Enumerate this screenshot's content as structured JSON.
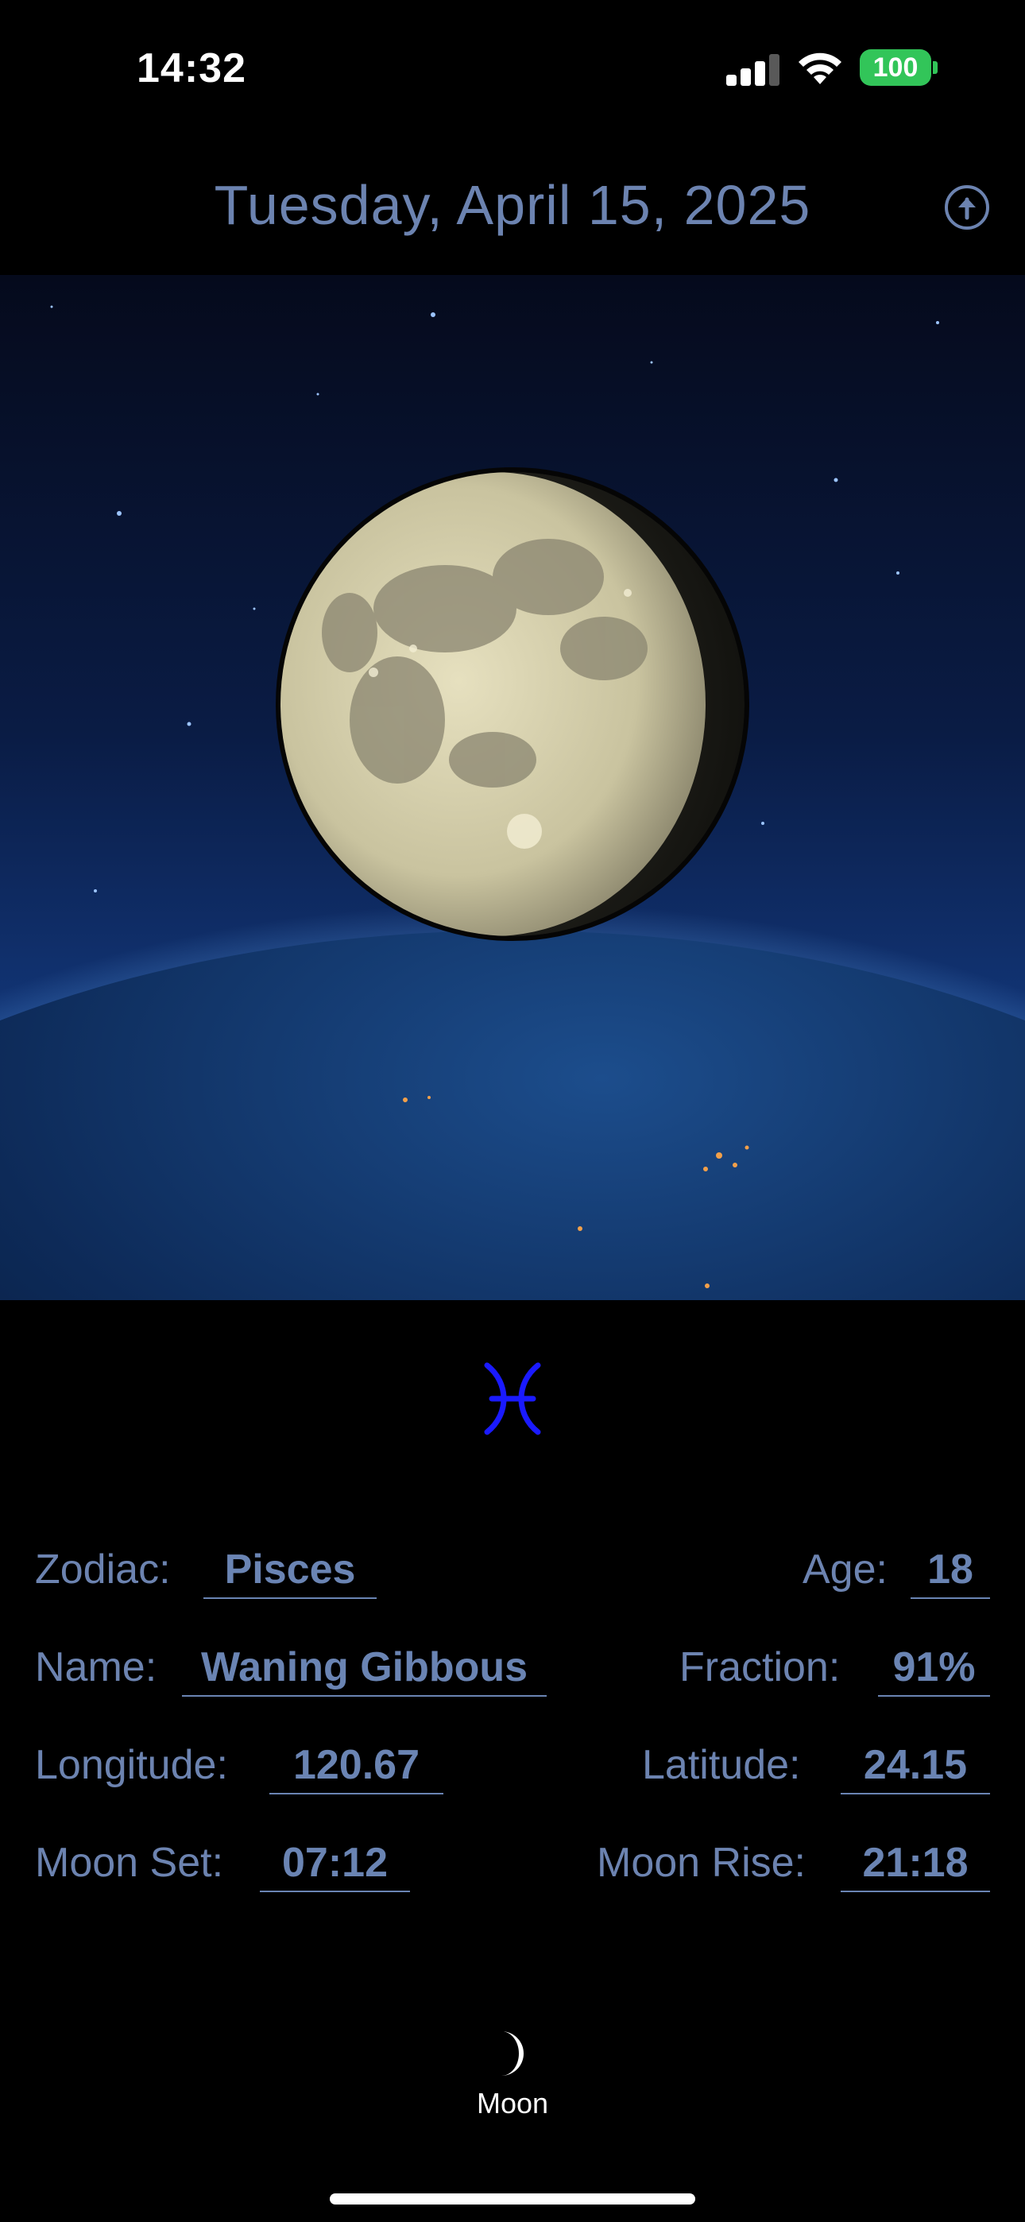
{
  "status_bar": {
    "time": "14:32",
    "battery": "100",
    "icons": [
      "cellular-signal-icon",
      "wifi-icon",
      "battery-icon"
    ]
  },
  "header": {
    "date": "Tuesday, April 15, 2025",
    "action_icon": "upload-arrow-circle-icon"
  },
  "scene": {
    "image": "moon-over-earth-illustration",
    "phase_fraction": 0.91
  },
  "zodiac": {
    "symbol": "♓",
    "icon": "pisces-icon"
  },
  "info": {
    "zodiac_label": "Zodiac:",
    "zodiac_value": "Pisces",
    "age_label": "Age:",
    "age_value": "18",
    "name_label": "Name:",
    "name_value": "Waning Gibbous",
    "fraction_label": "Fraction:",
    "fraction_value": "91%",
    "longitude_label": "Longitude:",
    "longitude_value": "120.67",
    "latitude_label": "Latitude:",
    "latitude_value": "24.15",
    "moonset_label": "Moon Set:",
    "moonset_value": "07:12",
    "moonrise_label": "Moon Rise:",
    "moonrise_value": "21:18"
  },
  "tab_bar": {
    "tabs": [
      {
        "label": "Moon",
        "icon": "crescent-moon-icon",
        "selected": true
      }
    ]
  },
  "colors": {
    "background": "#000000",
    "accent_text": "#6c83b0",
    "zodiac_symbol": "#1a1aff",
    "battery": "#32c559"
  }
}
